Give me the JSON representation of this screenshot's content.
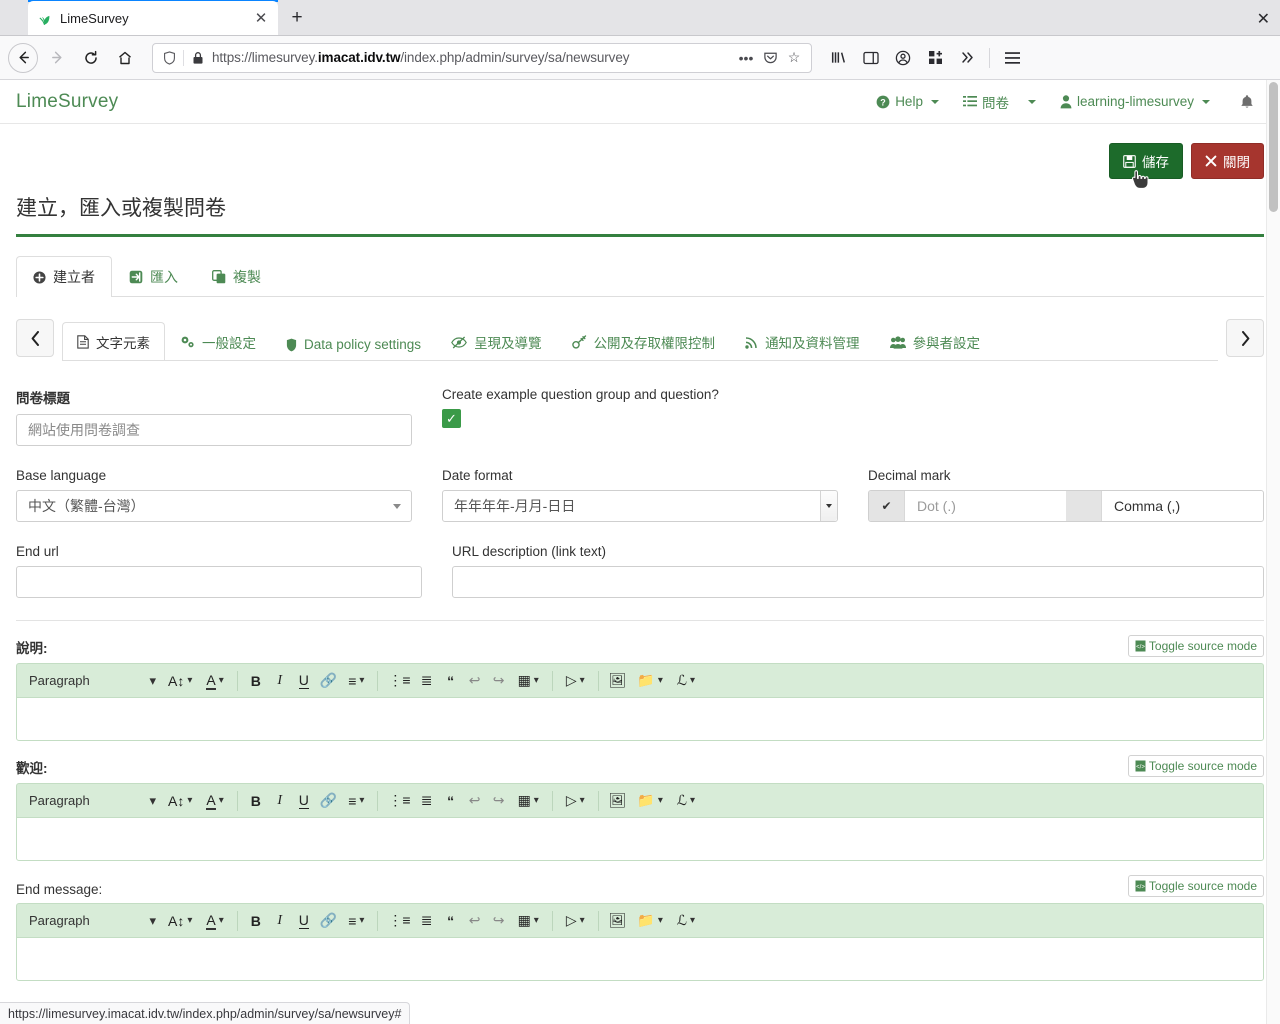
{
  "browser": {
    "tab": {
      "title": "LimeSurvey",
      "favicon": "limesurvey-icon",
      "close": "✕"
    },
    "new_tab": "+",
    "window_close": "✕",
    "nav": {
      "back": "←",
      "forward": "→",
      "reload": "↻",
      "home": "⌂"
    },
    "url": {
      "prefix": "https://limesurvey.",
      "domain": "imacat.idv.tw",
      "path": "/index.php/admin/survey/sa/newsurvey",
      "full": "https://limesurvey.imacat.idv.tw/index.php/admin/survey/sa/newsurvey",
      "shield_icon": "tracking-protection-icon",
      "lock_icon": "padlock-icon",
      "more_icon": "•••",
      "pocket_icon": "pocket-icon",
      "star_icon": "☆"
    },
    "toolbar_icons": [
      "library-icon",
      "sidebar-icon",
      "account-icon",
      "extensions-icon",
      "overflow-icon",
      "menu-icon"
    ],
    "status_bar": "https://limesurvey.imacat.idv.tw/index.php/admin/survey/sa/newsurvey#"
  },
  "app": {
    "brand": "LimeSurvey",
    "nav": [
      {
        "label": "Help",
        "icon": "help-circle-icon",
        "caret": true
      },
      {
        "label": "問卷",
        "icon": "list-icon",
        "caret": true
      },
      {
        "label": "learning-limesurvey",
        "icon": "user-icon",
        "caret": true
      }
    ],
    "notification_icon": "bell-icon"
  },
  "actions": {
    "save": {
      "label": "儲存",
      "icon": "floppy-icon"
    },
    "close": {
      "label": "關閉",
      "icon": "times-icon"
    }
  },
  "page": {
    "title": "建立，匯入或複製問卷"
  },
  "main_tabs": [
    {
      "label": "建立者",
      "icon": "plus-circle-icon",
      "active": true
    },
    {
      "label": "匯入",
      "icon": "import-icon",
      "active": false
    },
    {
      "label": "複製",
      "icon": "copy-icon",
      "active": false
    }
  ],
  "sub_tabs": {
    "prev": "‹",
    "next": "›",
    "items": [
      {
        "label": "文字元素",
        "icon": "file-text-icon",
        "active": true
      },
      {
        "label": "一般設定",
        "icon": "cogs-icon",
        "active": false
      },
      {
        "label": "Data policy settings",
        "icon": "shield-icon",
        "active": false
      },
      {
        "label": "呈現及導覽",
        "icon": "eye-slash-icon",
        "active": false
      },
      {
        "label": "公開及存取權限控制",
        "icon": "key-icon",
        "active": false
      },
      {
        "label": "通知及資料管理",
        "icon": "rss-icon",
        "active": false
      },
      {
        "label": "參與者設定",
        "icon": "users-icon",
        "active": false
      }
    ]
  },
  "form": {
    "survey_title": {
      "label": "問卷標題",
      "value": "網站使用問卷調查"
    },
    "example_question": {
      "label": "Create example question group and question?",
      "checked": true,
      "check_glyph": "✓"
    },
    "base_language": {
      "label": "Base language",
      "value": "中文（繁體-台灣）"
    },
    "date_format": {
      "label": "Date format",
      "value": "年年年年-月月-日日"
    },
    "decimal_mark": {
      "label": "Decimal mark",
      "options": [
        {
          "label": "Dot (.)",
          "selected": true,
          "mark": "✔"
        },
        {
          "label": "Comma (,)",
          "selected": false,
          "mark": ""
        }
      ]
    },
    "end_url": {
      "label": "End url",
      "value": ""
    },
    "url_description": {
      "label": "URL description (link text)",
      "value": ""
    }
  },
  "editors": [
    {
      "label": "說明:",
      "bold": true,
      "content": ""
    },
    {
      "label": "歡迎:",
      "bold": true,
      "content": ""
    },
    {
      "label": "End message:",
      "bold": false,
      "content": ""
    }
  ],
  "editor_ui": {
    "toggle_source": "Toggle source mode",
    "toggle_icon": "source-code-icon",
    "paragraph_label": "Paragraph",
    "tools": [
      {
        "name": "font-size-icon",
        "glyph": "A↕",
        "caret": true
      },
      {
        "name": "font-color-icon",
        "glyph": "A",
        "caret": true,
        "underline": true
      },
      {
        "name": "bold-icon",
        "glyph": "B",
        "caret": false
      },
      {
        "name": "italic-icon",
        "glyph": "I",
        "caret": false
      },
      {
        "name": "underline-icon",
        "glyph": "U",
        "caret": false
      },
      {
        "name": "link-icon",
        "glyph": "🔗",
        "caret": false
      },
      {
        "name": "align-icon",
        "glyph": "≡",
        "caret": true
      },
      {
        "name": "bullet-list-icon",
        "glyph": "☰",
        "caret": false
      },
      {
        "name": "numbered-list-icon",
        "glyph": "≣",
        "caret": false
      },
      {
        "name": "blockquote-icon",
        "glyph": "“",
        "caret": false
      },
      {
        "name": "undo-icon",
        "glyph": "↩",
        "caret": false
      },
      {
        "name": "redo-icon",
        "glyph": "↪",
        "caret": false
      },
      {
        "name": "table-icon",
        "glyph": "▦",
        "caret": true
      },
      {
        "name": "media-icon",
        "glyph": "▶",
        "caret": true
      },
      {
        "name": "image-icon",
        "glyph": "🖼",
        "caret": false
      },
      {
        "name": "file-manager-icon",
        "glyph": "📁",
        "caret": true
      },
      {
        "name": "special-char-icon",
        "glyph": "ℒ",
        "caret": true
      }
    ]
  },
  "colors": {
    "brand_green": "#4d8a54",
    "save_green": "#1d6b2b",
    "close_red": "#a6352e",
    "title_rule": "#34803f",
    "toolbar_bg": "#d8ecd8",
    "checkbox_green": "#3a9a48"
  }
}
